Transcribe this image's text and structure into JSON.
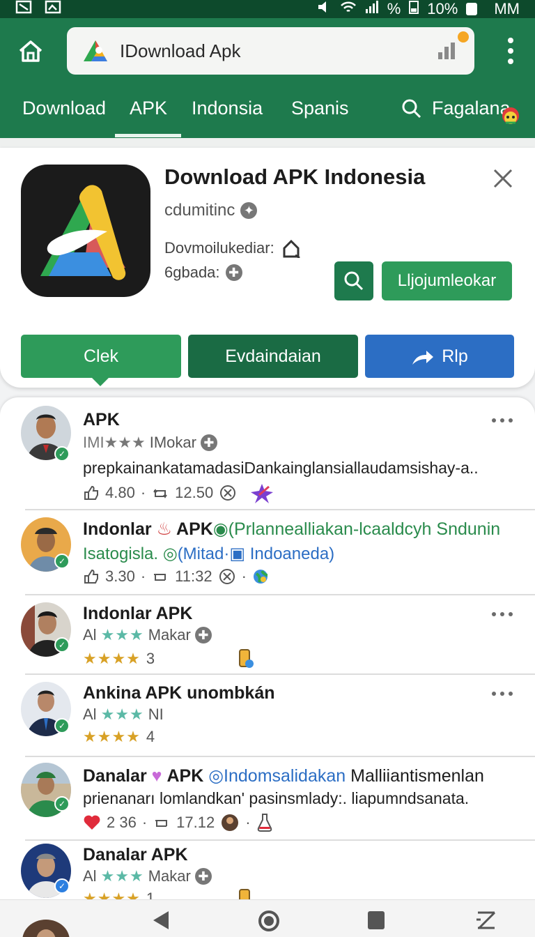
{
  "status_bar": {
    "battery": "10%",
    "carrier": "MM",
    "signal_mark": "%"
  },
  "app_bar": {
    "url_text": "IDownload Apk",
    "tabs": [
      {
        "label": "Download",
        "active": false
      },
      {
        "label": "APK",
        "active": true
      },
      {
        "label": "Indonsia",
        "active": false
      },
      {
        "label": "Spanis",
        "active": false
      }
    ],
    "search_tab": "Fagalana"
  },
  "app_card": {
    "title": "Download APK Indonesia",
    "developer": "cdumitinc",
    "downloads_label": "Dovmoilukediar:",
    "size_label": "6gbada:",
    "action_label": "Lljojumleokar",
    "buttons": {
      "click": "Clek",
      "download": "Evdaindaian",
      "share": "Rlp"
    }
  },
  "list": {
    "items": [
      {
        "title": "APK",
        "sub_prefix": "IMI★★★",
        "sub": "IMokar",
        "desc": "prepkainankatamadasiDankainglansiallaudamsishay-a..",
        "likes": "4.80",
        "reposts": "12.50"
      },
      {
        "title": "Indonlar",
        "title_apk": "APK",
        "title_green": "(Prlannealliakan-lcaaldcyh Sndunin",
        "line2_green": "Isatogisla.",
        "line2_blue_a": "(Mitad·",
        "line2_blue_b": "Indoaneda)",
        "likes": "3.30",
        "reposts": "11:32"
      },
      {
        "title": "Indonlar APK",
        "sub_prefix": "Al",
        "stars": "★★★",
        "sub": "Makar",
        "gold_stars": "★★★★",
        "rating": "3"
      },
      {
        "title": "Ankina APK unombkán",
        "sub_prefix": "Al",
        "stars": "★★★",
        "sub": "NI",
        "gold_stars": "★★★★",
        "rating": "4"
      },
      {
        "title": "Danalar",
        "title_apk": "APK",
        "title_blue": "Indomsalidakan",
        "title_rest": "Malliiantismenlan",
        "desc": "prienanarı lomlandkan' pasinsmlady:. liapumndsanata.",
        "likes": "2 36",
        "reposts": "17.12"
      },
      {
        "title": "Danalar APK",
        "sub_prefix": "Al",
        "stars": "★★★",
        "sub": "Makar",
        "gold_stars": "★★★★",
        "rating": "1"
      }
    ]
  },
  "colors": {
    "primary": "#1e7a4d",
    "accent_green": "#2e9b5a",
    "blue": "#2c6ec4",
    "status_bar": "#0d4a2c"
  }
}
